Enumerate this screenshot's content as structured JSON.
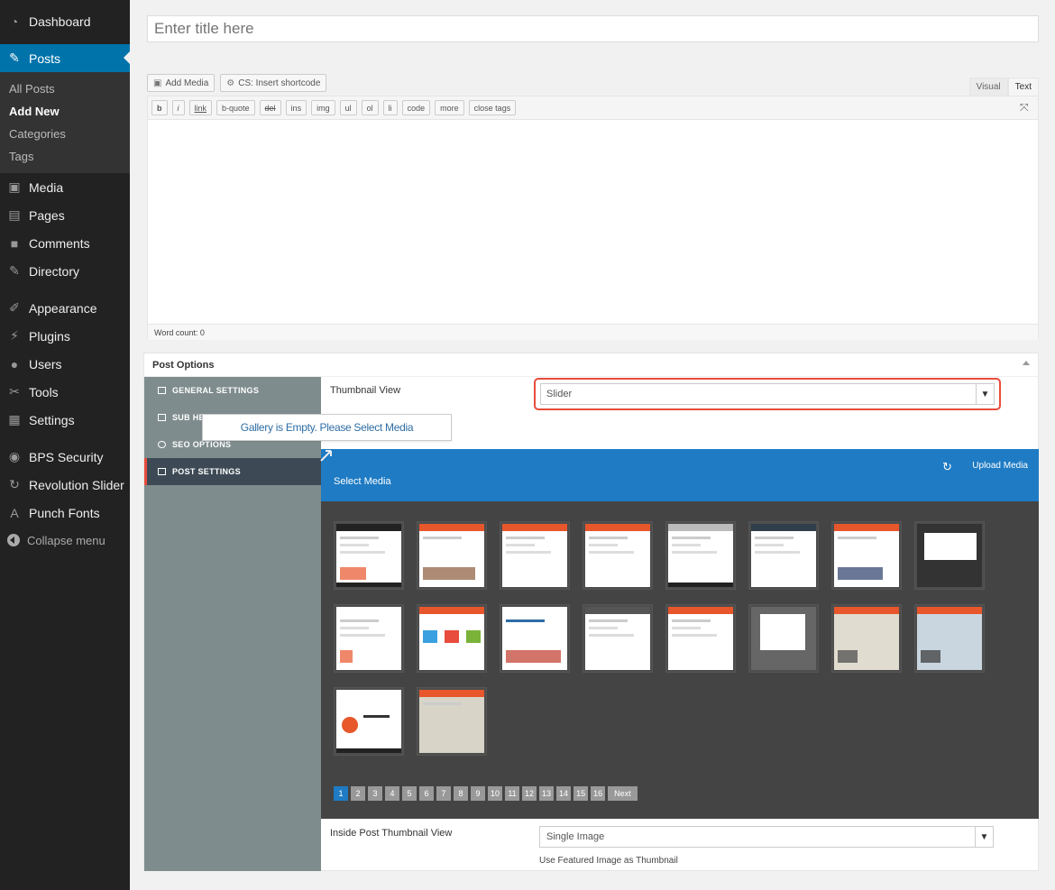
{
  "sidebar": {
    "items": [
      {
        "label": "Dashboard",
        "icon": "dashboard-icon"
      },
      {
        "label": "Posts",
        "icon": "pin-icon"
      },
      {
        "label": "Media",
        "icon": "media-icon"
      },
      {
        "label": "Pages",
        "icon": "pages-icon"
      },
      {
        "label": "Comments",
        "icon": "comments-icon"
      },
      {
        "label": "Directory",
        "icon": "pin-icon"
      },
      {
        "label": "Appearance",
        "icon": "appearance-icon"
      },
      {
        "label": "Plugins",
        "icon": "plugins-icon"
      },
      {
        "label": "Users",
        "icon": "users-icon"
      },
      {
        "label": "Tools",
        "icon": "tools-icon"
      },
      {
        "label": "Settings",
        "icon": "settings-icon"
      },
      {
        "label": "BPS Security",
        "icon": "shield-icon"
      },
      {
        "label": "Revolution Slider",
        "icon": "refresh-icon"
      },
      {
        "label": "Punch Fonts",
        "icon": "font-icon"
      }
    ],
    "posts_submenu": [
      "All Posts",
      "Add New",
      "Categories",
      "Tags"
    ],
    "collapse": "Collapse menu"
  },
  "title": {
    "placeholder": "Enter title here"
  },
  "editor": {
    "add_media": "Add Media",
    "insert_shortcode": "CS: Insert shortcode",
    "tab_visual": "Visual",
    "tab_text": "Text",
    "quicktags": [
      "b",
      "i",
      "link",
      "b-quote",
      "del",
      "ins",
      "img",
      "ul",
      "ol",
      "li",
      "code",
      "more",
      "close tags"
    ],
    "word_count": "Word count: 0"
  },
  "post_options": {
    "title": "Post Options",
    "nav": [
      "GENERAL SETTINGS",
      "SUB HEADER OPTIONS",
      "SEO OPTIONS",
      "POST SETTINGS"
    ],
    "thumbnail_view_label": "Thumbnail View",
    "thumbnail_view_value": "Slider",
    "tooltip": "Gallery is Empty. Please Select Media",
    "select_media": "Select Media",
    "upload_media": "Upload Media",
    "pages": [
      "1",
      "2",
      "3",
      "4",
      "5",
      "6",
      "7",
      "8",
      "9",
      "10",
      "11",
      "12",
      "13",
      "14",
      "15",
      "16"
    ],
    "next": "Next",
    "inside_label": "Inside Post Thumbnail View",
    "inside_value": "Single Image",
    "inside_hint": "Use Featured Image as Thumbnail"
  },
  "colors": {
    "accent": "#0073aa",
    "media_header": "#1e7bc4",
    "highlight": "#e74c3c"
  }
}
